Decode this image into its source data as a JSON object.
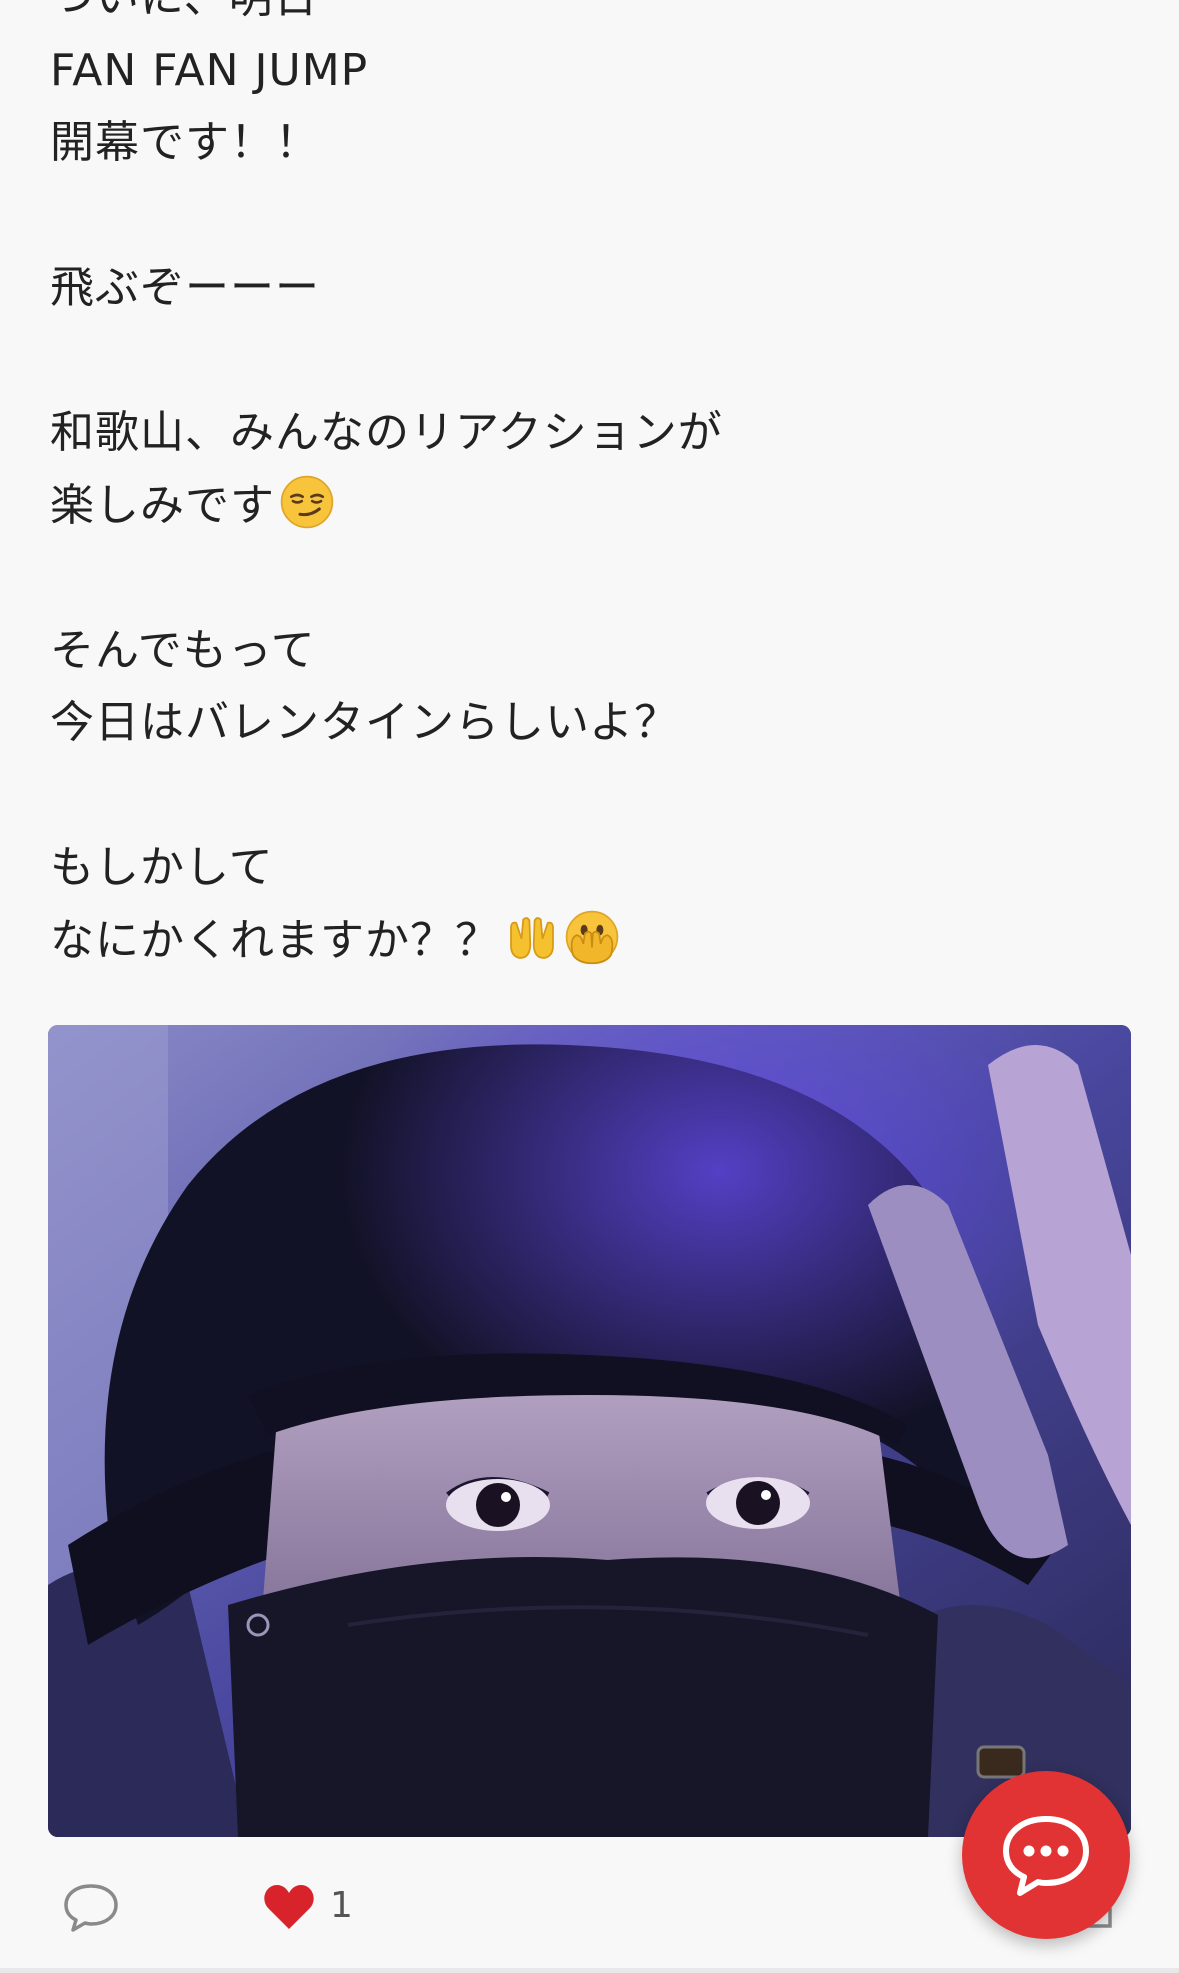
{
  "post": {
    "lines": [
      "ついに、明日",
      "FAN FAN JUMP",
      "開幕です！！",
      "",
      "飛ぶぞーーー",
      "",
      "和歌山、みんなのリアクションが",
      "楽しみです",
      "",
      "そんでもって",
      "今日はバレンタインらしいよ？",
      "",
      "もしかして",
      "なにかくれますか？？"
    ],
    "emojis": {
      "line8": "smirking-face",
      "line14": [
        "palms-up-together",
        "face-with-open-eyes-and-hand-over-mouth"
      ]
    }
  },
  "photo": {
    "subject": "selfie-photo"
  },
  "actions": {
    "comment_icon": "speech-bubble-icon",
    "like_icon": "heart-icon",
    "like_count": "1",
    "like_color": "#d8232a",
    "fab_icon": "chat-dots-icon",
    "fab_color": "#e23334"
  }
}
